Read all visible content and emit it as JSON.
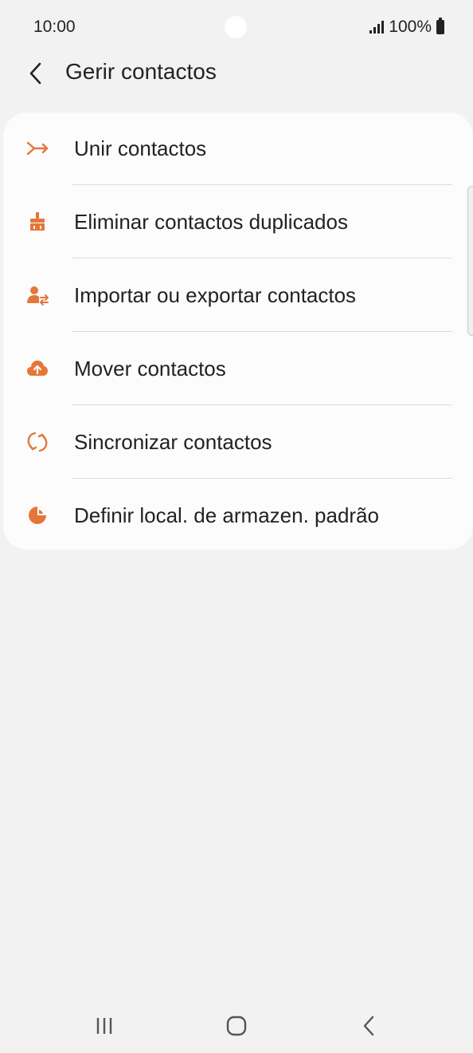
{
  "status_bar": {
    "time": "10:00",
    "battery_text": "100%",
    "icons": [
      "signal-icon",
      "battery-icon"
    ]
  },
  "header": {
    "back_icon": "chevron-left-icon",
    "title": "Gerir contactos"
  },
  "menu": {
    "accent_color": "#e4763a",
    "items": [
      {
        "label": "Unir contactos",
        "icon": "merge-icon"
      },
      {
        "label": "Eliminar contactos duplicados",
        "icon": "broom-icon"
      },
      {
        "label": "Importar ou exportar contactos",
        "icon": "person-transfer-icon"
      },
      {
        "label": "Mover contactos",
        "icon": "cloud-upload-icon"
      },
      {
        "label": "Sincronizar contactos",
        "icon": "sync-icon"
      },
      {
        "label": "Definir local. de armazen. padrão",
        "icon": "storage-pie-icon"
      }
    ]
  },
  "nav_bar": {
    "icons": [
      "recent-apps-icon",
      "home-icon",
      "back-icon"
    ]
  }
}
